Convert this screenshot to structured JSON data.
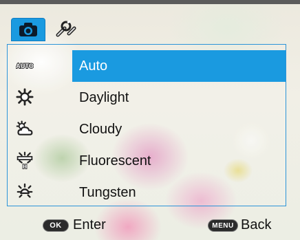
{
  "tabs": [
    {
      "icon": "camera-icon",
      "selected": true
    },
    {
      "icon": "settings-wrench-icon",
      "selected": false
    }
  ],
  "white_balance_menu": {
    "selected_index": 0,
    "items": [
      {
        "label": "Auto",
        "icon": "wb-auto-icon",
        "icon_text": "AUTO"
      },
      {
        "label": "Daylight",
        "icon": "wb-daylight-icon"
      },
      {
        "label": "Cloudy",
        "icon": "wb-cloudy-icon"
      },
      {
        "label": "Fluorescent",
        "icon": "wb-fluorescent-icon"
      },
      {
        "label": "Tungsten",
        "icon": "wb-tungsten-icon"
      }
    ]
  },
  "footer": {
    "ok_key": "OK",
    "enter_label": "Enter",
    "menu_key": "MENU",
    "back_label": "Back"
  },
  "colors": {
    "accent": "#1a9ae0",
    "text": "#111111",
    "selected_text": "#ffffff"
  }
}
